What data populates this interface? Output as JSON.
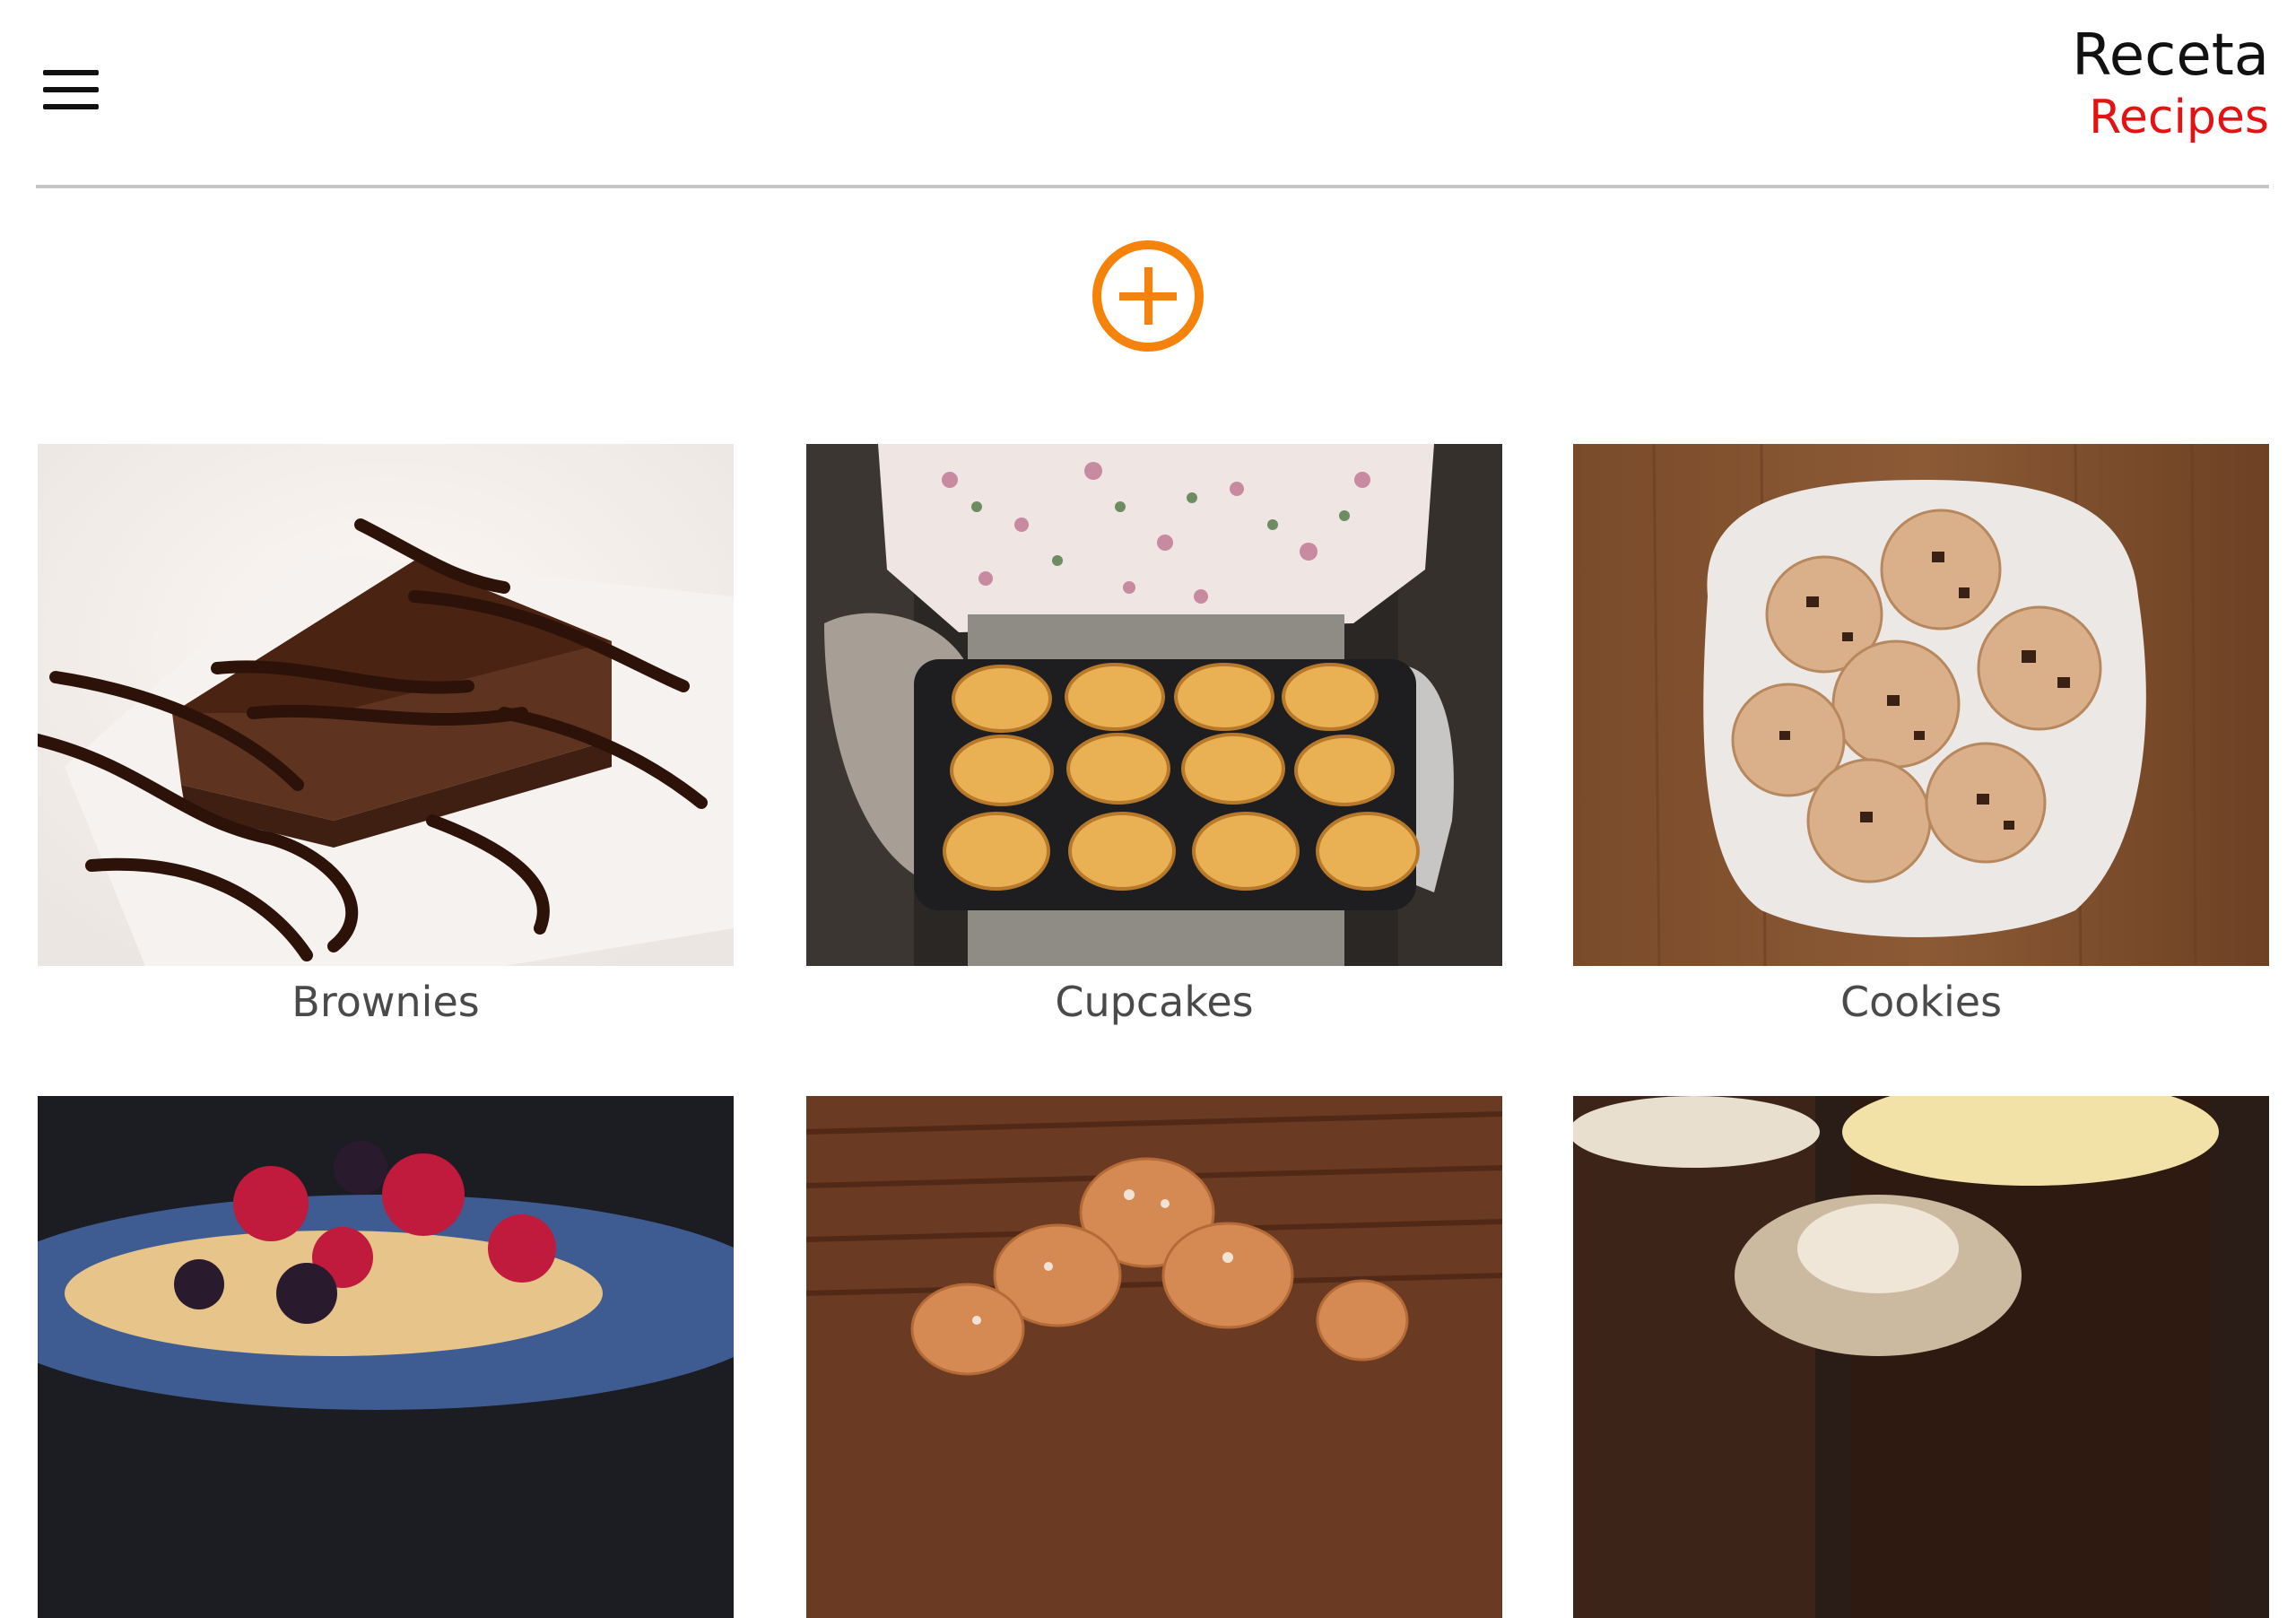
{
  "header": {
    "title": "Receta",
    "subtitle": "Recipes",
    "menu_icon": "hamburger-menu-icon"
  },
  "actions": {
    "add_icon": "plus-circle-icon"
  },
  "colors": {
    "accent": "#f5820a",
    "subtitle": "#e41212",
    "divider": "#c6c6c6",
    "label": "#4a4a4a"
  },
  "recipes": [
    {
      "name": "Brownies",
      "image": "brownie-with-chocolate-drizzle-photo"
    },
    {
      "name": "Cupcakes",
      "image": "muffin-tray-held-by-baker-photo"
    },
    {
      "name": "Cookies",
      "image": "chocolate-chip-cookies-plate-photo"
    },
    {
      "name": "",
      "image": "berries-dessert-photo"
    },
    {
      "name": "",
      "image": "powdered-doughnuts-photo"
    },
    {
      "name": "",
      "image": "chocolate-pudding-cups-photo"
    }
  ]
}
